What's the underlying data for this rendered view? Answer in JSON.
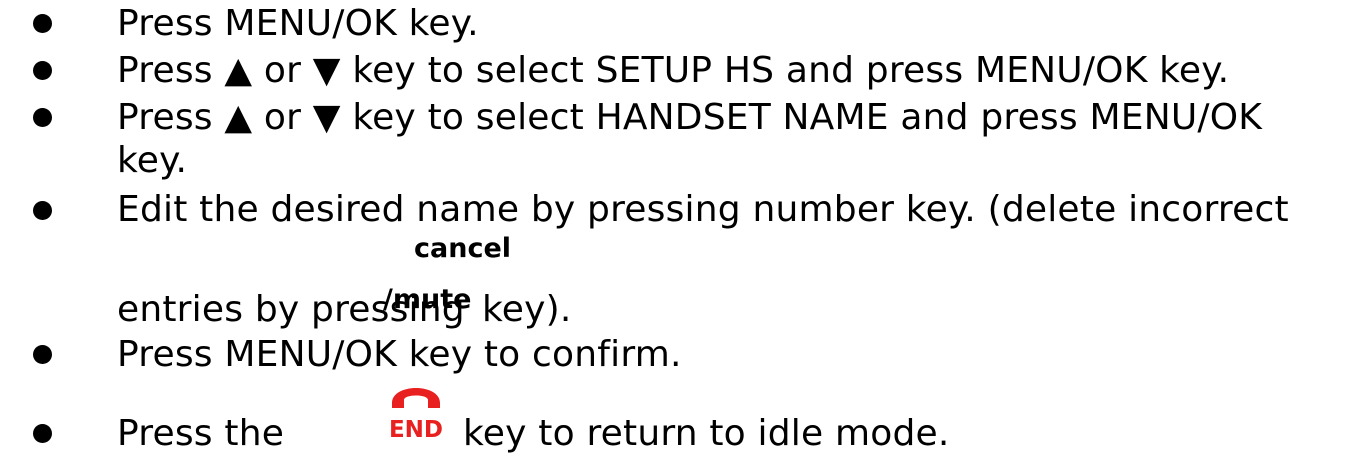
{
  "instructions": {
    "step1": "Press MENU/OK key.",
    "step2": "Press ▲ or ▼ key to select SETUP HS and press MENU/OK key.",
    "step3_line1": "Press ▲ or ▼ key to select HANDSET NAME and press MENU/OK",
    "step3_line2": "key.",
    "step4_line1": "Edit the desired name by pressing number key. (delete incorrect",
    "step4_line2_prefix": "entries by pressing",
    "step4_key_top": "cancel",
    "step4_key_bottom": "/mute",
    "step4_line2_suffix": "key).",
    "step5": "Press MENU/OK key to confirm.",
    "step6_prefix": "Press the",
    "step6_key_label": "END",
    "step6_suffix": "key to return to idle mode."
  },
  "colors": {
    "end_key": "#e8201f",
    "text": "#000000"
  },
  "icons": {
    "end_key": "red-phone-handset-icon"
  }
}
